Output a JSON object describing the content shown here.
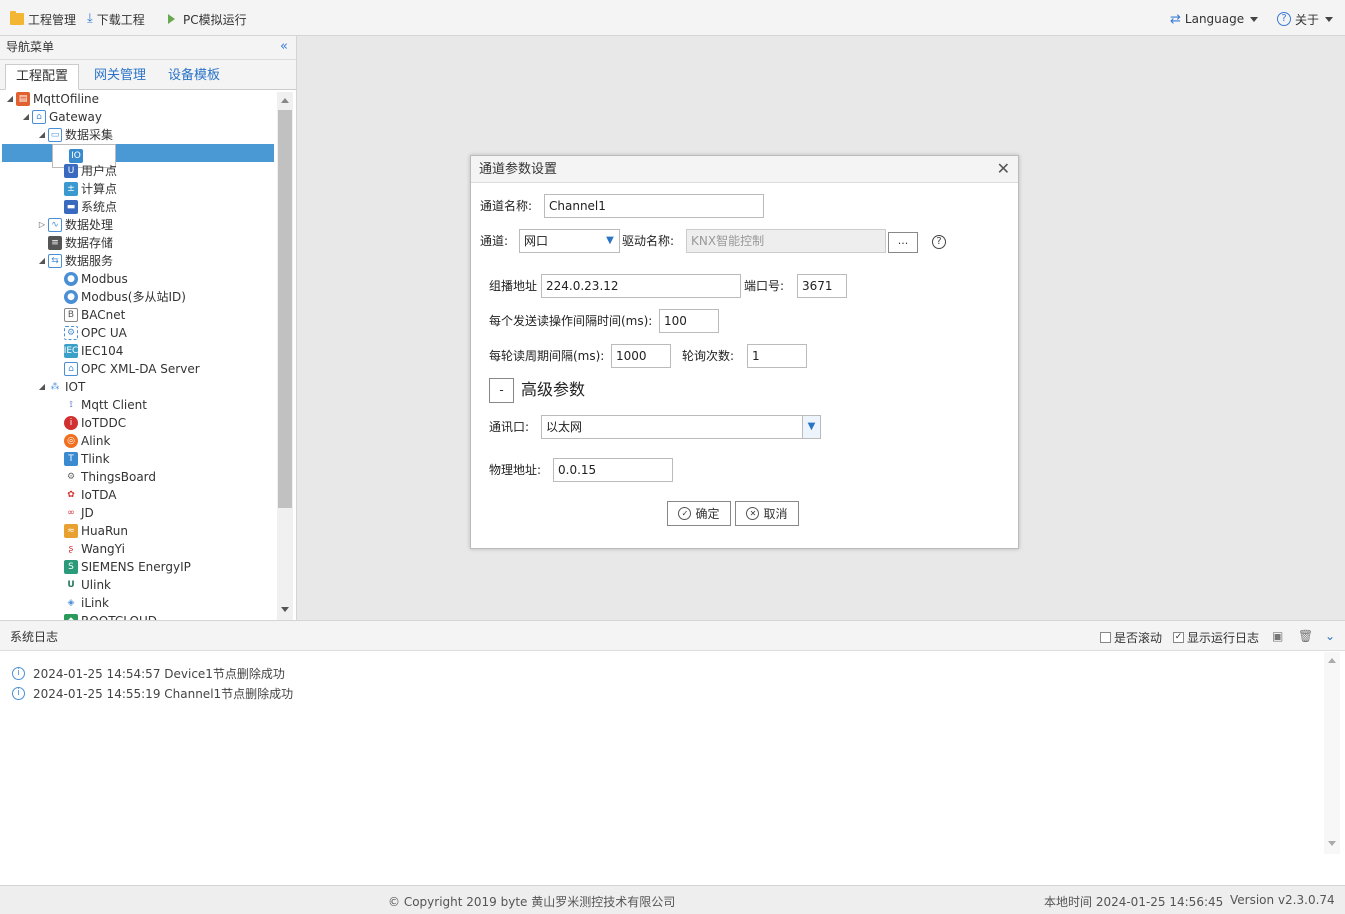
{
  "toolbar": {
    "project_mgmt": "工程管理",
    "download": "下载工程",
    "simulate": "PC模拟运行",
    "language": "Language",
    "about": "关于"
  },
  "nav": {
    "title": "导航菜单",
    "tabs": [
      "工程配置",
      "网关管理",
      "设备模板"
    ],
    "tree": [
      {
        "label": "MqttOfiline"
      },
      {
        "label": "Gateway"
      },
      {
        "label": "数据采集"
      },
      {
        "label": "I/O点"
      },
      {
        "label": "用户点"
      },
      {
        "label": "计算点"
      },
      {
        "label": "系统点"
      },
      {
        "label": "数据处理"
      },
      {
        "label": "数据存储"
      },
      {
        "label": "数据服务"
      },
      {
        "label": "Modbus"
      },
      {
        "label": "Modbus(多从站ID)"
      },
      {
        "label": "BACnet"
      },
      {
        "label": "OPC UA"
      },
      {
        "label": "IEC104"
      },
      {
        "label": "OPC XML-DA Server"
      },
      {
        "label": "IOT"
      },
      {
        "label": "Mqtt Client"
      },
      {
        "label": "IoTDDC"
      },
      {
        "label": "Alink"
      },
      {
        "label": "Tlink"
      },
      {
        "label": "ThingsBoard"
      },
      {
        "label": "IoTDA"
      },
      {
        "label": "JD"
      },
      {
        "label": "HuaRun"
      },
      {
        "label": "WangYi"
      },
      {
        "label": "SIEMENS EnergyIP"
      },
      {
        "label": "Ulink"
      },
      {
        "label": "iLink"
      },
      {
        "label": "ROOTCLOUD"
      }
    ]
  },
  "dialog": {
    "title": "通道参数设置",
    "channel_name_label": "通道名称:",
    "channel_name_value": "Channel1",
    "channel_label": "通道:",
    "channel_value": "网口",
    "driver_label": "驱动名称:",
    "driver_value": "KNX智能控制",
    "browse_label": "...",
    "multicast_label": "组播地址",
    "multicast_value": "224.0.23.12",
    "port_label": "端口号:",
    "port_value": "3671",
    "interval_label": "每个发送读操作间隔时间(ms):",
    "interval_value": "100",
    "cycle_label": "每轮读周期间隔(ms):",
    "cycle_value": "1000",
    "poll_label": "轮询次数:",
    "poll_value": "1",
    "advanced_toggle": "-",
    "advanced_label": "高级参数",
    "comm_port_label": "通讯口:",
    "comm_port_value": "以太网",
    "phys_addr_label": "物理地址:",
    "phys_addr_value": "0.0.15",
    "ok_label": "确定",
    "cancel_label": "取消"
  },
  "log": {
    "title": "系统日志",
    "scroll_label": "是否滚动",
    "show_label": "显示运行日志",
    "entries": [
      "2024-01-25 14:54:57 Device1节点删除成功",
      "2024-01-25 14:55:19 Channel1节点删除成功"
    ]
  },
  "footer": {
    "copyright": "© Copyright 2019 byte 黄山罗米测控技术有限公司",
    "local_time": "本地时间 2024-01-25 14:56:45",
    "version": "Version v2.3.0.74"
  },
  "colors": {
    "accent": "#2a73c7",
    "selection": "#4a98d4"
  }
}
